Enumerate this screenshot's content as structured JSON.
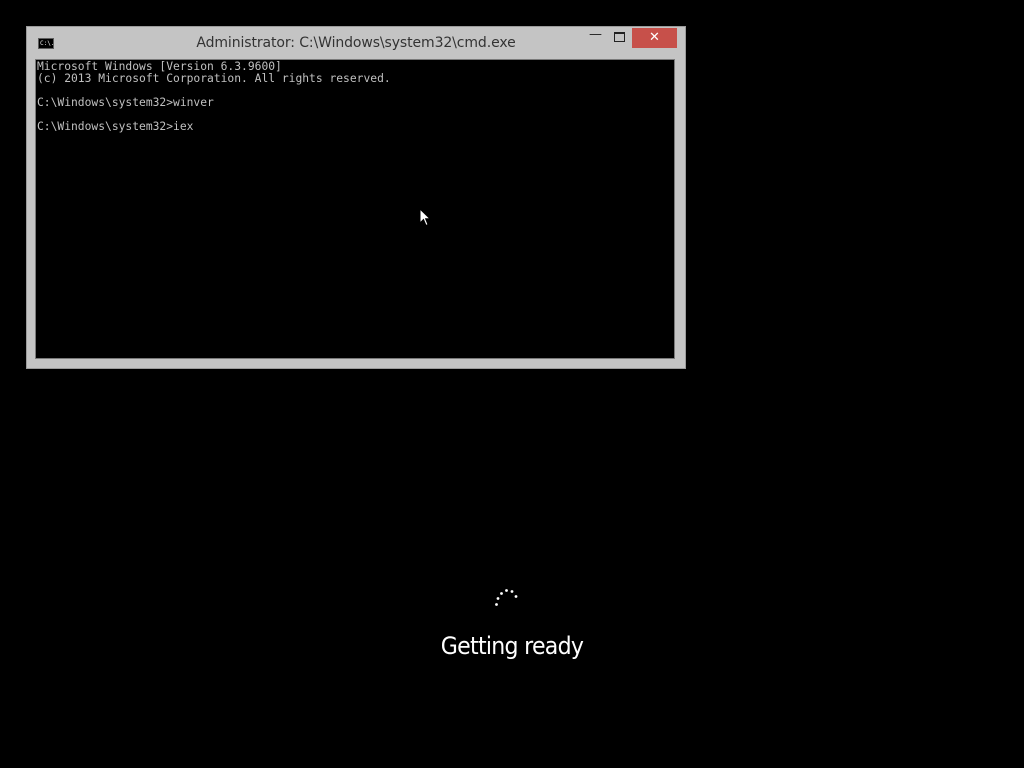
{
  "window": {
    "title": "Administrator: C:\\Windows\\system32\\cmd.exe",
    "icon": "cmd-console-icon",
    "icon_label": "C:\\.",
    "controls": {
      "minimize": "—",
      "close": "✕"
    }
  },
  "console": {
    "lines": [
      "Microsoft Windows [Version 6.3.9600]",
      "(c) 2013 Microsoft Corporation. All rights reserved.",
      "C:\\Windows\\system32>winver",
      "C:\\Windows\\system32>iex"
    ],
    "colors": {
      "background": "#000000",
      "text": "#c0c0c0"
    }
  },
  "setup": {
    "status_text": "Getting ready",
    "spinner_icon": "loading-dots-icon"
  },
  "colors": {
    "screen_background": "#000000",
    "close_button": "#c7504a",
    "window_frame": "#c4c4c4"
  }
}
